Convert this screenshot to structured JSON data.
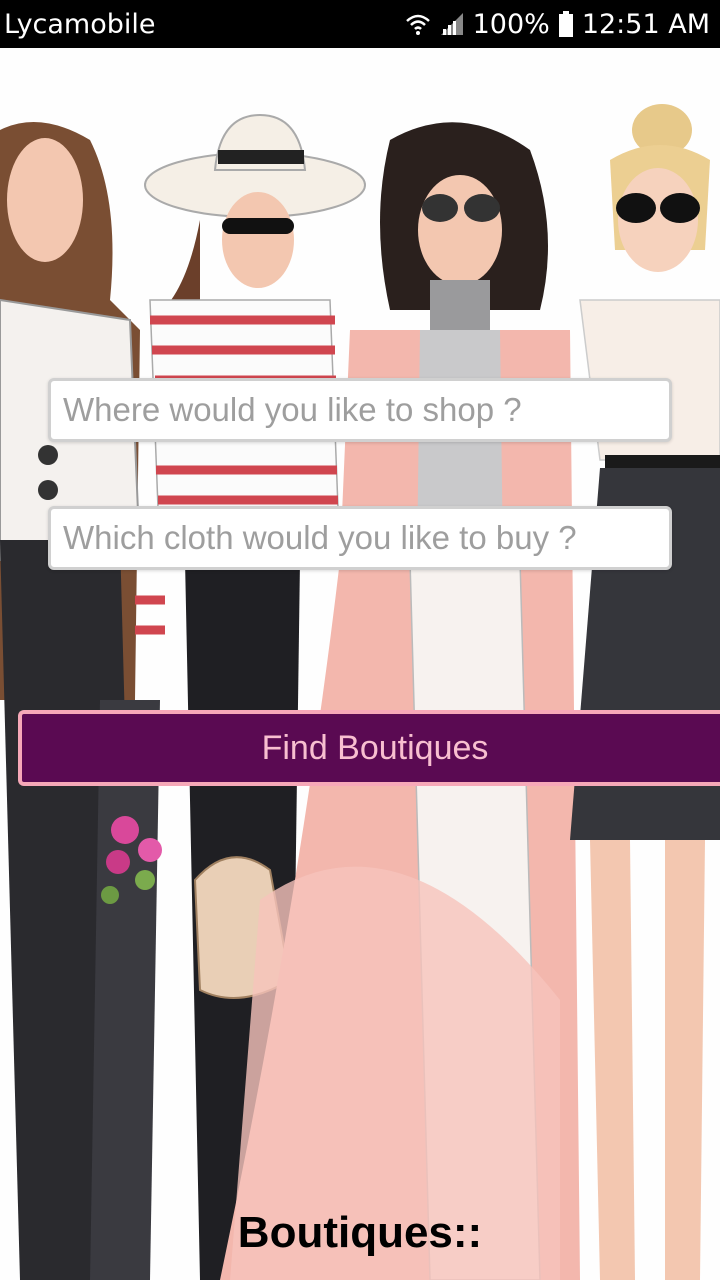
{
  "status_bar": {
    "carrier": "Lycamobile",
    "battery": "100%",
    "time": "12:51 AM"
  },
  "search": {
    "shop_placeholder": "Where would you like to shop ?",
    "cloth_placeholder": "Which cloth would you like to buy ?"
  },
  "actions": {
    "find_label": "Find Boutiques"
  },
  "results": {
    "heading": "Boutiques::"
  },
  "colors": {
    "button_bg": "#5a0a52",
    "button_border": "#f6a8b8",
    "button_text": "#f8bfd0"
  },
  "icons": [
    "wifi-icon",
    "signal-icon",
    "battery-icon"
  ]
}
